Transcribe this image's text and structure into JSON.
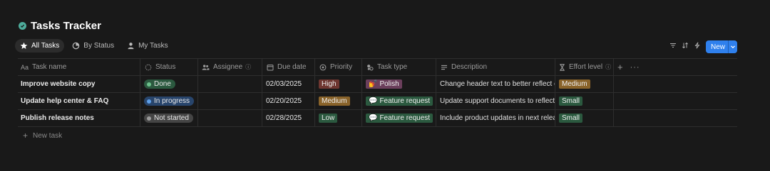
{
  "page": {
    "title": "Tasks Tracker"
  },
  "views": [
    {
      "label": "All Tasks",
      "icon": "star-icon",
      "active": true
    },
    {
      "label": "By Status",
      "icon": "status-icon",
      "active": false
    },
    {
      "label": "My Tasks",
      "icon": "person-icon",
      "active": false
    }
  ],
  "toolbar": {
    "new_label": "New"
  },
  "columns": {
    "name": "Task name",
    "status": "Status",
    "assignee": "Assignee",
    "due": "Due date",
    "priority": "Priority",
    "type": "Task type",
    "description": "Description",
    "effort": "Effort level"
  },
  "rows": [
    {
      "name": "Improve website copy",
      "status": "Done",
      "due": "02/03/2025",
      "priority": "High",
      "type_emoji": "💅",
      "type": "Polish",
      "description": "Change header text to better reflect our",
      "effort": "Medium"
    },
    {
      "name": "Update help center & FAQ",
      "status": "In progress",
      "due": "02/20/2025",
      "priority": "Medium",
      "type_emoji": "💬",
      "type": "Feature request",
      "description": "Update support documents to reflect ne",
      "effort": "Small"
    },
    {
      "name": "Publish release notes",
      "status": "Not started",
      "due": "02/28/2025",
      "priority": "Low",
      "type_emoji": "💬",
      "type": "Feature request",
      "description": "Include product updates in next release",
      "effort": "Small"
    }
  ],
  "new_task_label": "New task",
  "colors": {
    "done": "#2b593f",
    "done_dot": "#6cc08b",
    "in_progress": "#28456c",
    "in_progress_dot": "#5e9fe8",
    "not_started": "#454545",
    "not_started_dot": "#9b9b9b",
    "high": "#6e3630",
    "medium": "#89632a",
    "low": "#2b593f",
    "polish": "#6b3f5c",
    "feature_request": "#2b593f",
    "effort_medium": "#89632a",
    "effort_small": "#2b593f",
    "accent": "#2f80ed"
  }
}
